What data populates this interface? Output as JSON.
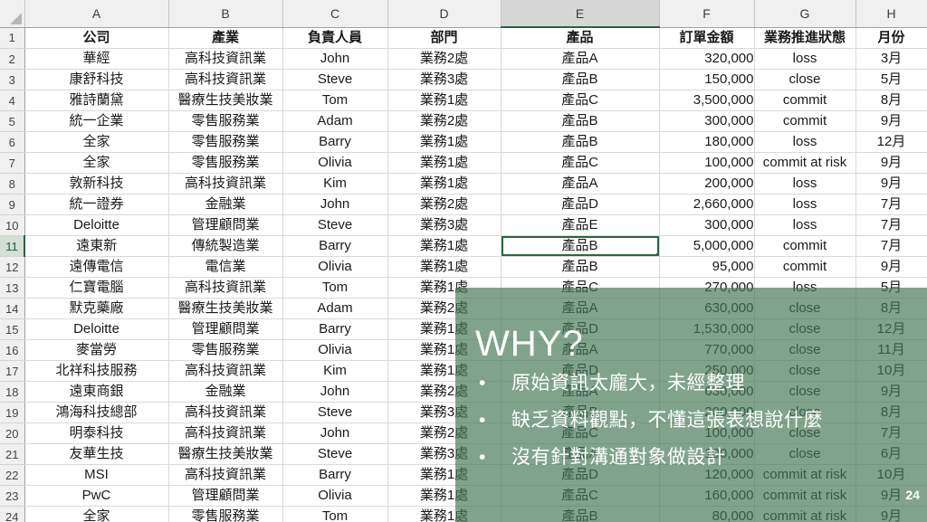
{
  "sheet": {
    "corner_icon": "select-all-triangle-icon",
    "column_letters": [
      "A",
      "B",
      "C",
      "D",
      "E",
      "F",
      "G",
      "H"
    ],
    "selected_column": "E",
    "selected_row": "11",
    "selected_cell": "E11",
    "row_numbers": [
      "1",
      "2",
      "3",
      "4",
      "5",
      "6",
      "7",
      "8",
      "9",
      "10",
      "11",
      "12",
      "13",
      "14",
      "15",
      "16",
      "17",
      "18",
      "19",
      "20",
      "21",
      "22",
      "23",
      "24"
    ],
    "headers": [
      "公司",
      "產業",
      "負責人員",
      "部門",
      "產品",
      "訂單金額",
      "業務推進狀態",
      "月份"
    ],
    "rows": [
      [
        "華經",
        "高科技資訊業",
        "John",
        "業務2處",
        "產品A",
        "320,000",
        "loss",
        "3月"
      ],
      [
        "康舒科技",
        "高科技資訊業",
        "Steve",
        "業務3處",
        "產品B",
        "150,000",
        "close",
        "5月"
      ],
      [
        "雅詩蘭黛",
        "醫療生技美妝業",
        "Tom",
        "業務1處",
        "產品C",
        "3,500,000",
        "commit",
        "8月"
      ],
      [
        "統一企業",
        "零售服務業",
        "Adam",
        "業務2處",
        "產品B",
        "300,000",
        "commit",
        "9月"
      ],
      [
        "全家",
        "零售服務業",
        "Barry",
        "業務1處",
        "產品B",
        "180,000",
        "loss",
        "12月"
      ],
      [
        "全家",
        "零售服務業",
        "Olivia",
        "業務1處",
        "產品C",
        "100,000",
        "commit at risk",
        "9月"
      ],
      [
        "敦新科技",
        "高科技資訊業",
        "Kim",
        "業務1處",
        "產品A",
        "200,000",
        "loss",
        "9月"
      ],
      [
        "統一證券",
        "金融業",
        "John",
        "業務2處",
        "產品D",
        "2,660,000",
        "loss",
        "7月"
      ],
      [
        "Deloitte",
        "管理顧問業",
        "Steve",
        "業務3處",
        "產品E",
        "300,000",
        "loss",
        "7月"
      ],
      [
        "遠東新",
        "傳統製造業",
        "Barry",
        "業務1處",
        "產品B",
        "5,000,000",
        "commit",
        "7月"
      ],
      [
        "遠傳電信",
        "電信業",
        "Olivia",
        "業務1處",
        "產品B",
        "95,000",
        "commit",
        "9月"
      ],
      [
        "仁寶電腦",
        "高科技資訊業",
        "Tom",
        "業務1處",
        "產品C",
        "270,000",
        "loss",
        "5月"
      ],
      [
        "默克藥廠",
        "醫療生技美妝業",
        "Adam",
        "業務2處",
        "產品A",
        "630,000",
        "close",
        "8月"
      ],
      [
        "Deloitte",
        "管理顧問業",
        "Barry",
        "業務1處",
        "產品D",
        "1,530,000",
        "close",
        "12月"
      ],
      [
        "麥當勞",
        "零售服務業",
        "Olivia",
        "業務1處",
        "產品A",
        "770,000",
        "close",
        "11月"
      ],
      [
        "北祥科技服務",
        "高科技資訊業",
        "Kim",
        "業務1處",
        "產品D",
        "250,000",
        "close",
        "10月"
      ],
      [
        "遠東商銀",
        "金融業",
        "John",
        "業務2處",
        "產品A",
        "630,000",
        "close",
        "9月"
      ],
      [
        "鴻海科技總部",
        "高科技資訊業",
        "Steve",
        "業務3處",
        "產品B",
        "200,000",
        "close",
        "8月"
      ],
      [
        "明泰科技",
        "高科技資訊業",
        "John",
        "業務2處",
        "產品C",
        "100,000",
        "close",
        "7月"
      ],
      [
        "友華生技",
        "醫療生技美妝業",
        "Steve",
        "業務3處",
        "產品A",
        "100,000",
        "close",
        "6月"
      ],
      [
        "MSI",
        "高科技資訊業",
        "Barry",
        "業務1處",
        "產品D",
        "120,000",
        "commit at risk",
        "10月"
      ],
      [
        "PwC",
        "管理顧問業",
        "Olivia",
        "業務1處",
        "產品C",
        "160,000",
        "commit at risk",
        "9月"
      ],
      [
        "全家",
        "零售服務業",
        "Tom",
        "業務1處",
        "產品B",
        "80,000",
        "commit at risk",
        "9月"
      ]
    ]
  },
  "overlay": {
    "title": "WHY?",
    "bullet_glyph": "•",
    "bullets": [
      "原始資訊太龐大，未經整理",
      "缺乏資料觀點，不懂這張表想說什麼",
      "沒有針對溝通對象做設計"
    ],
    "page_number": "24",
    "accent_color": "#467855",
    "text_color": "#ffffff"
  }
}
